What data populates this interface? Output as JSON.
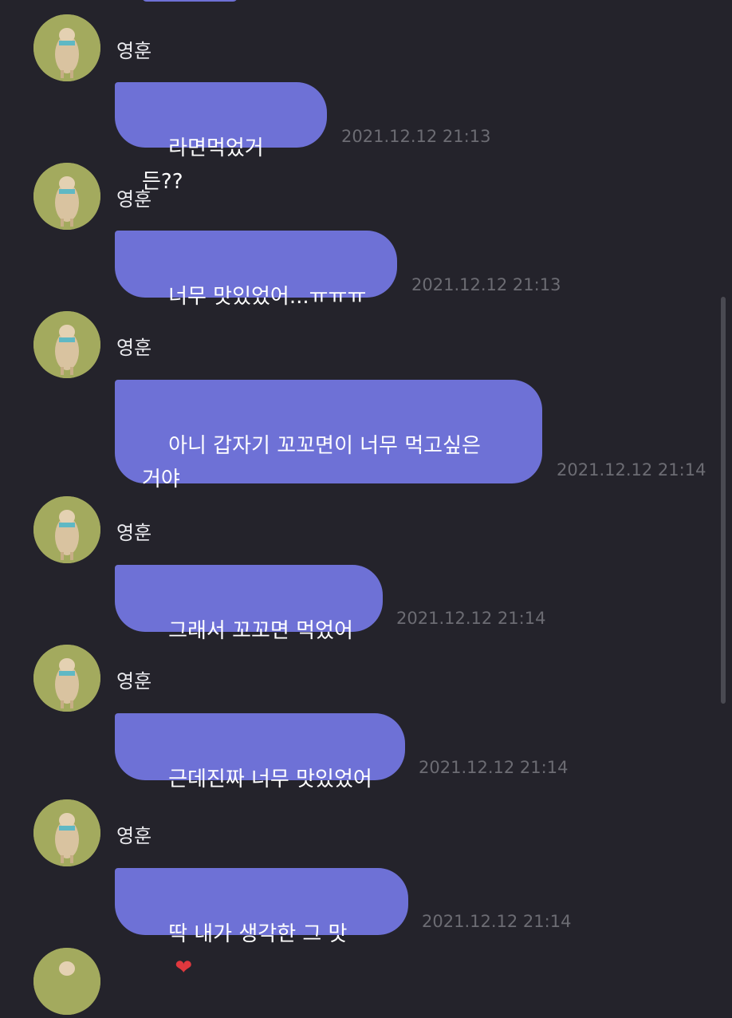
{
  "sender": "영훈",
  "avatar_icon": "dog-avatar-icon",
  "colors": {
    "background": "#24232b",
    "bubble": "#6e71d6",
    "timestamp": "#6c6c73",
    "heart": "#e0383e"
  },
  "messages": [
    {
      "text": "라면먹었거든??",
      "time": "2021.12.12 21:13"
    },
    {
      "text": "너무 맛있었어...ㅠㅠㅠ",
      "time": "2021.12.12 21:13"
    },
    {
      "text": "아니 갑자기 꼬꼬면이 너무 먹고싶은\n거야",
      "time": "2021.12.12 21:14"
    },
    {
      "text": "그래서 꼬꼬면 먹었어",
      "time": "2021.12.12 21:14"
    },
    {
      "text": "근데진짜 너무 맛있었어",
      "time": "2021.12.12 21:14"
    },
    {
      "text": "딱 내가 생각한 그 맛",
      "emoji": "❤",
      "time": "2021.12.12 21:14"
    }
  ]
}
